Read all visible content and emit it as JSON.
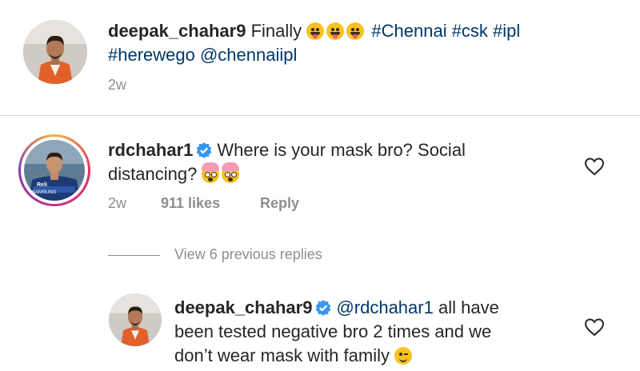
{
  "caption": {
    "username": "deepak_chahar9",
    "text": "Finally",
    "hashtags_line1": "#Chennai #csk #ipl",
    "line2": "#herewego @chennaiipl",
    "age": "2w"
  },
  "comment": {
    "username": "rdchahar1",
    "verified": true,
    "text_line1": "Where is your mask bro? Social",
    "text_line2": "distancing?",
    "age": "2w",
    "likes": "911 likes",
    "reply_label": "Reply",
    "avatar_jersey_text_1": "Reli",
    "avatar_jersey_text_2": "SAMSUNG"
  },
  "view_replies": "View 6 previous replies",
  "reply": {
    "username": "deepak_chahar9",
    "verified": true,
    "mention": "@rdchahar1",
    "text_line1": "all have",
    "text_line2": "been tested negative bro 2 times and we",
    "text_line3": "don’t wear mask with family"
  },
  "icons": {
    "caption_emoji": "face-with-tongue-icon",
    "comment_emoji": "exploding-head-icon",
    "reply_emoji": "winking-face-icon",
    "like": "heart-outline-icon",
    "verified": "verified-badge-icon"
  },
  "colors": {
    "text": "#262626",
    "link": "#00376b",
    "muted": "#8e8e8e",
    "verified": "#3897f0"
  }
}
